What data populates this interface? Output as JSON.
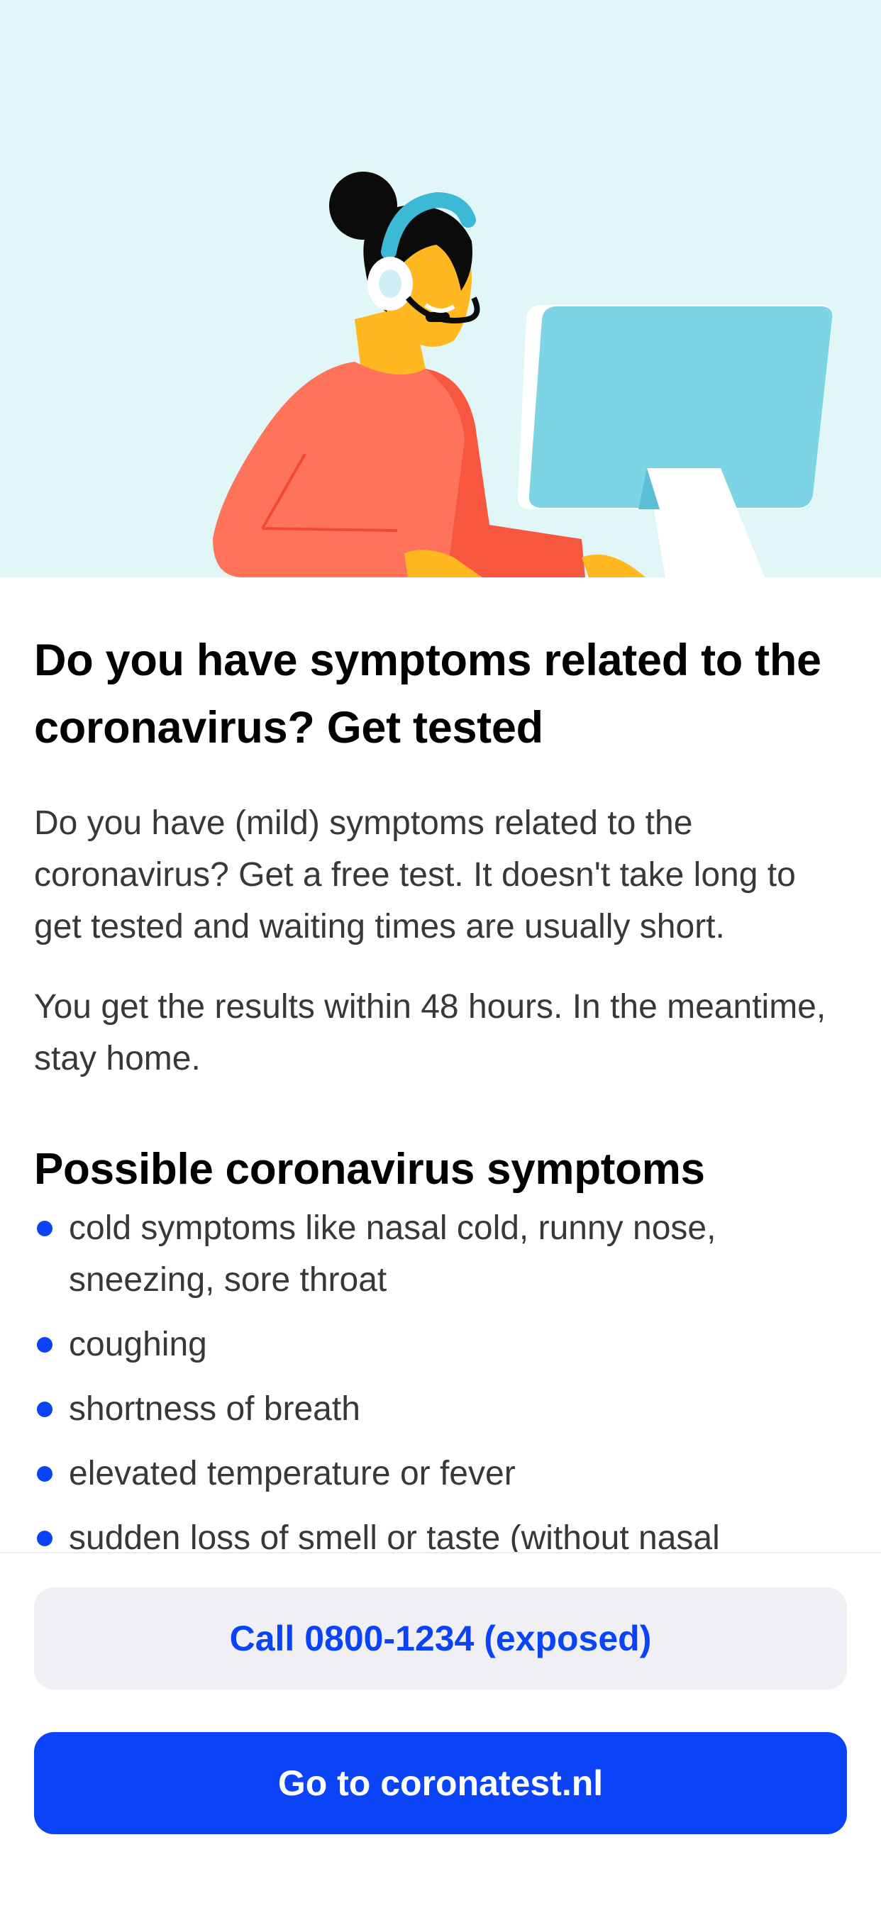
{
  "colors": {
    "accent": "#0b44f6",
    "hero_background": "#e1f6f6",
    "secondary_button_background": "#efeff4"
  },
  "hero": {
    "illustration": "helpdesk-agent-with-headset-at-computer"
  },
  "main": {
    "title": "Do you have symptoms related to the coronavirus? Get tested",
    "paragraphs": [
      "Do you have (mild) symptoms related to the coronavirus? Get a free test. It doesn't take long to get tested and waiting times are usually short.",
      "You get the results within 48 hours. In the meantime, stay home."
    ],
    "symptoms_heading": "Possible coronavirus symptoms",
    "symptoms": [
      "cold symptoms like nasal cold, runny nose, sneezing, sore throat",
      "coughing",
      "shortness of breath",
      "elevated temperature or fever",
      "sudden loss of smell or taste (without nasal"
    ]
  },
  "footer": {
    "call_button_label": "Call 0800-1234 (exposed)",
    "website_button_label": "Go to coronatest.nl"
  }
}
